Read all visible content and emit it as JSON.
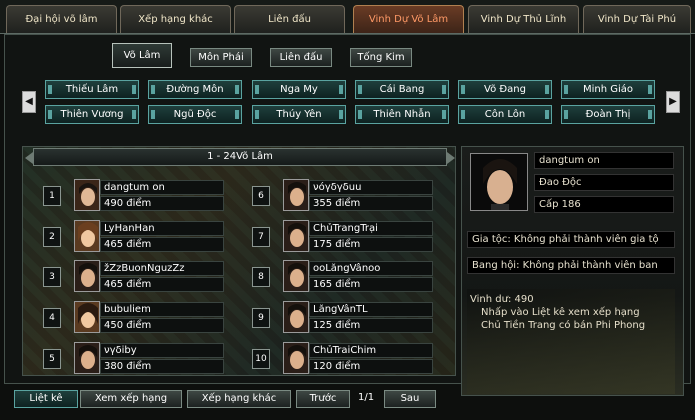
{
  "top_tabs": [
    {
      "label": "Đại hội võ lâm"
    },
    {
      "label": "Xếp hạng khác"
    },
    {
      "label": "Liên đấu"
    },
    {
      "label": "Vinh Dự Võ Lâm"
    },
    {
      "label": "Vinh Dự Thủ Lĩnh"
    },
    {
      "label": "Vinh Dự Tài Phú"
    }
  ],
  "sub_tabs": [
    {
      "label": "Võ Lâm"
    },
    {
      "label": "Môn Phái"
    },
    {
      "label": "Liên đấu"
    },
    {
      "label": "Tống Kim"
    }
  ],
  "factions_row1": [
    "Thiếu Lâm",
    "Đường Môn",
    "Nga My",
    "Cái Bang",
    "Võ Đang",
    "Minh Giáo"
  ],
  "factions_row2": [
    "Thiên Vương",
    "Ngũ Độc",
    "Thúy Yên",
    "Thiên Nhẫn",
    "Côn Lôn",
    "Đoàn Thị"
  ],
  "arrows": {
    "left": "◀",
    "right": "▶"
  },
  "ranking": {
    "header": "1 - 24Võ Lâm",
    "entries": [
      {
        "rank": "1",
        "name": "dangtum on",
        "score": "490 điểm"
      },
      {
        "rank": "2",
        "name": "LyHanHan",
        "score": "465 điểm"
      },
      {
        "rank": "3",
        "name": "žZzBuonNguzZz",
        "score": "465 điểm"
      },
      {
        "rank": "4",
        "name": "bubuliem",
        "score": "450 điểm"
      },
      {
        "rank": "5",
        "name": "νγδiby",
        "score": "380 điểm"
      },
      {
        "rank": "6",
        "name": "νόγδγδuu",
        "score": "355 điểm"
      },
      {
        "rank": "7",
        "name": "ChủTrangTrại",
        "score": "175 điểm"
      },
      {
        "rank": "8",
        "name": "ooLăngVânoo",
        "score": "165 điểm"
      },
      {
        "rank": "9",
        "name": "LăngVânTL",
        "score": "125 điểm"
      },
      {
        "rank": "10",
        "name": "ChủTraiChim",
        "score": "120 điểm"
      }
    ]
  },
  "profile": {
    "name": "dangtum on",
    "faction": "Đao Độc",
    "level": "Cấp 186",
    "family": "Gia tộc: Không phải thành viên gia tộ",
    "guild": "Bang hội: Không phải thành viên ban",
    "honor": "Vinh dư: 490",
    "hint1": "Nhấp vào Liệt kê xem xếp hạng",
    "hint2": "Chủ Tiền Trang có bán Phi Phong"
  },
  "bottom": {
    "list_btn": "Liệt kê",
    "view_rank_btn": "Xem xếp hạng",
    "other_rank_btn": "Xếp hạng khác",
    "prev_btn": "Trước",
    "page": "1/1",
    "next_btn": "Sau"
  },
  "colors": {
    "active_tab_text": "#ff9966",
    "teal_button_border": "#5aa3a0"
  }
}
